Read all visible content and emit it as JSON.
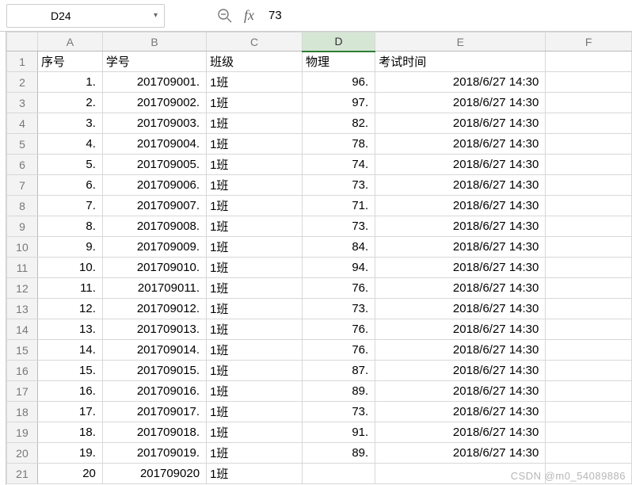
{
  "toolbar": {
    "cell_ref": "D24",
    "formula_value": "73"
  },
  "columns": [
    "A",
    "B",
    "C",
    "D",
    "E",
    "F"
  ],
  "headers": {
    "seq": "序号",
    "sid": "学号",
    "class": "班级",
    "physics": "物理",
    "exam_time": "考试时间"
  },
  "rows": [
    {
      "n": 1,
      "seq": "1.",
      "sid": "201709001.",
      "class": "1班",
      "phy": "96.",
      "time": "2018/6/27 14:30"
    },
    {
      "n": 2,
      "seq": "2.",
      "sid": "201709002.",
      "class": "1班",
      "phy": "97.",
      "time": "2018/6/27 14:30"
    },
    {
      "n": 3,
      "seq": "3.",
      "sid": "201709003.",
      "class": "1班",
      "phy": "82.",
      "time": "2018/6/27 14:30"
    },
    {
      "n": 4,
      "seq": "4.",
      "sid": "201709004.",
      "class": "1班",
      "phy": "78.",
      "time": "2018/6/27 14:30"
    },
    {
      "n": 5,
      "seq": "5.",
      "sid": "201709005.",
      "class": "1班",
      "phy": "74.",
      "time": "2018/6/27 14:30"
    },
    {
      "n": 6,
      "seq": "6.",
      "sid": "201709006.",
      "class": "1班",
      "phy": "73.",
      "time": "2018/6/27 14:30"
    },
    {
      "n": 7,
      "seq": "7.",
      "sid": "201709007.",
      "class": "1班",
      "phy": "71.",
      "time": "2018/6/27 14:30"
    },
    {
      "n": 8,
      "seq": "8.",
      "sid": "201709008.",
      "class": "1班",
      "phy": "73.",
      "time": "2018/6/27 14:30"
    },
    {
      "n": 9,
      "seq": "9.",
      "sid": "201709009.",
      "class": "1班",
      "phy": "84.",
      "time": "2018/6/27 14:30"
    },
    {
      "n": 10,
      "seq": "10.",
      "sid": "201709010.",
      "class": "1班",
      "phy": "94.",
      "time": "2018/6/27 14:30"
    },
    {
      "n": 11,
      "seq": "11.",
      "sid": "201709011.",
      "class": "1班",
      "phy": "76.",
      "time": "2018/6/27 14:30"
    },
    {
      "n": 12,
      "seq": "12.",
      "sid": "201709012.",
      "class": "1班",
      "phy": "73.",
      "time": "2018/6/27 14:30"
    },
    {
      "n": 13,
      "seq": "13.",
      "sid": "201709013.",
      "class": "1班",
      "phy": "76.",
      "time": "2018/6/27 14:30"
    },
    {
      "n": 14,
      "seq": "14.",
      "sid": "201709014.",
      "class": "1班",
      "phy": "76.",
      "time": "2018/6/27 14:30"
    },
    {
      "n": 15,
      "seq": "15.",
      "sid": "201709015.",
      "class": "1班",
      "phy": "87.",
      "time": "2018/6/27 14:30"
    },
    {
      "n": 16,
      "seq": "16.",
      "sid": "201709016.",
      "class": "1班",
      "phy": "89.",
      "time": "2018/6/27 14:30"
    },
    {
      "n": 17,
      "seq": "17.",
      "sid": "201709017.",
      "class": "1班",
      "phy": "73.",
      "time": "2018/6/27 14:30"
    },
    {
      "n": 18,
      "seq": "18.",
      "sid": "201709018.",
      "class": "1班",
      "phy": "91.",
      "time": "2018/6/27 14:30"
    },
    {
      "n": 19,
      "seq": "19.",
      "sid": "201709019.",
      "class": "1班",
      "phy": "89.",
      "time": "2018/6/27 14:30"
    },
    {
      "n": 20,
      "seq": "20",
      "sid": "201709020",
      "class": "1班",
      "phy": "",
      "time": ""
    }
  ],
  "watermark": "CSDN @m0_54089886"
}
